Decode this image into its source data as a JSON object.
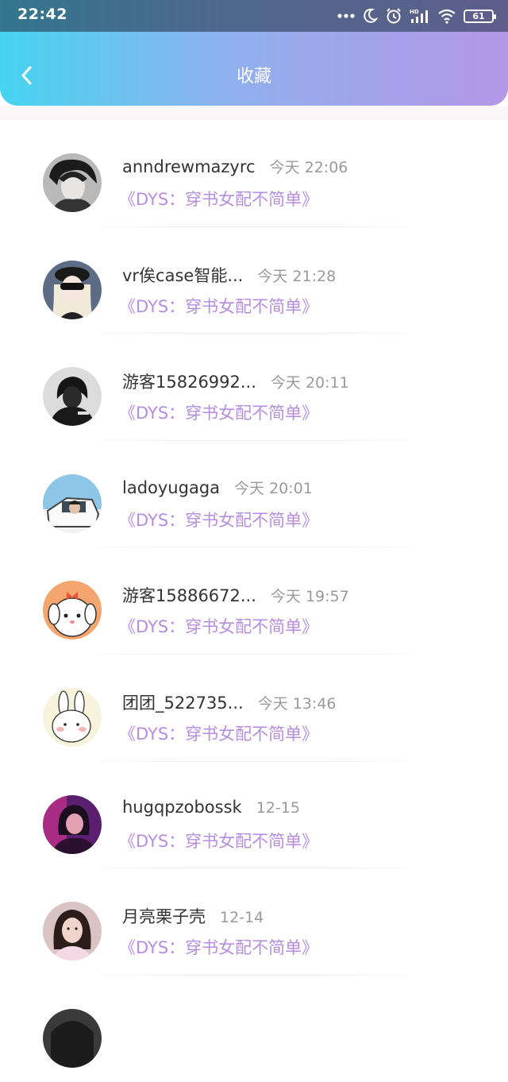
{
  "status_bar": {
    "time": "22:42",
    "battery": "61",
    "icons": [
      "dots-icon",
      "moon-icon",
      "alarm-icon",
      "hd-signal-icon",
      "wifi-icon",
      "battery-icon"
    ]
  },
  "header": {
    "title": "收藏",
    "back_icon": "chevron-left-icon"
  },
  "colors": {
    "gradient_start": "#45d4f0",
    "gradient_end": "#b597e8",
    "book_title": "#b68ee0",
    "username": "#333333",
    "time": "#9a9a9a"
  },
  "items": [
    {
      "username": "anndrewmazyrc",
      "time": "今天 22:06",
      "book": "《DYS：穿书女配不简单》"
    },
    {
      "username": "vr俟case智能...",
      "time": "今天 21:28",
      "book": "《DYS：穿书女配不简单》"
    },
    {
      "username": "游客15826992...",
      "time": "今天 20:11",
      "book": "《DYS：穿书女配不简单》"
    },
    {
      "username": "ladoyugaga",
      "time": "今天 20:01",
      "book": "《DYS：穿书女配不简单》"
    },
    {
      "username": "游客15886672...",
      "time": "今天 19:57",
      "book": "《DYS：穿书女配不简单》"
    },
    {
      "username": "团团_522735...",
      "time": "今天 13:46",
      "book": "《DYS：穿书女配不简单》"
    },
    {
      "username": "hugqpzobossk",
      "time": "12-15",
      "book": "《DYS：穿书女配不简单》"
    },
    {
      "username": "月亮栗子壳",
      "time": "12-14",
      "book": "《DYS：穿书女配不简单》"
    }
  ]
}
